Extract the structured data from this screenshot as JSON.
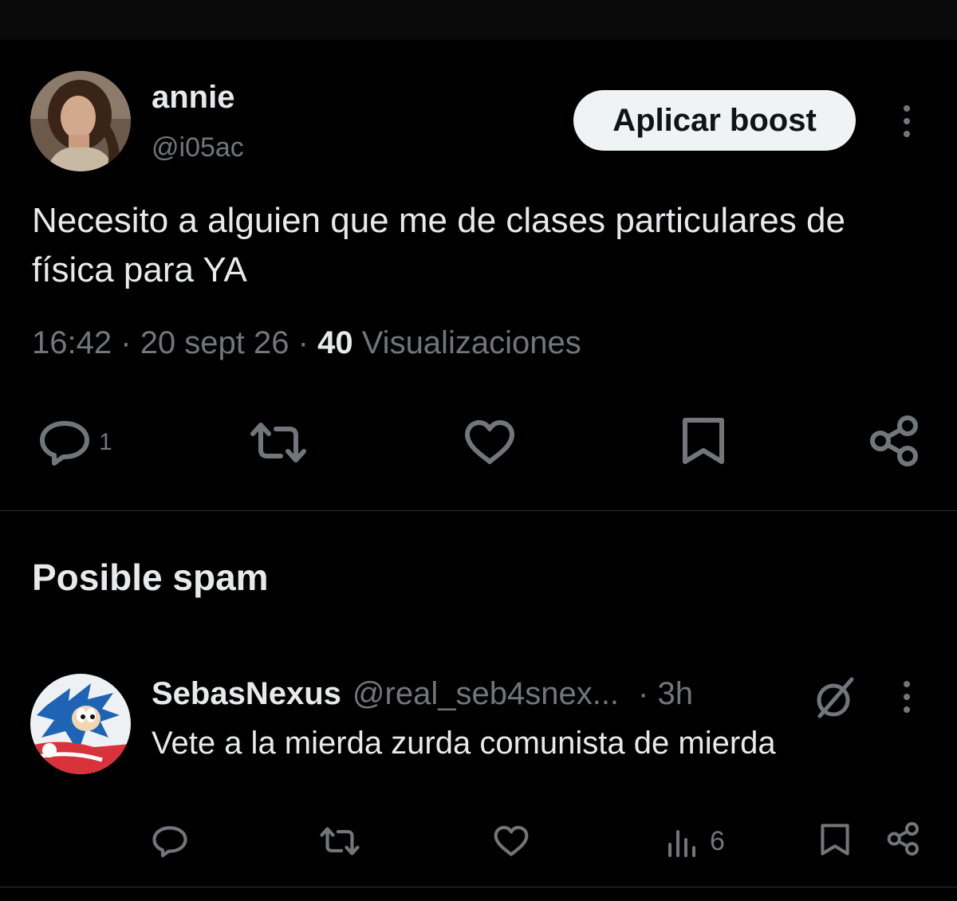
{
  "tweet": {
    "author_name": "annie",
    "author_handle": "@i05ac",
    "boost_label": "Aplicar boost",
    "text": "Necesito a alguien que me de clases particulares de física para YA",
    "time": "16:42",
    "date": "20 sept 26",
    "views_count": "40",
    "views_label": "Visualizaciones",
    "separator": "·",
    "actions": {
      "reply_count": "1"
    }
  },
  "spam_section": {
    "title": "Posible spam"
  },
  "reply": {
    "author_name": "SebasNexus",
    "author_handle": "@real_seb4snex...",
    "time": "· 3h",
    "text": "Vete a la mierda zurda comunista de mierda",
    "actions": {
      "views_count": "6"
    }
  },
  "icons": {
    "avatar_main": "avatar-photo",
    "avatar_reply": "sonic-avatar",
    "more": "more-vertical-icon",
    "reply": "comment-icon",
    "retweet": "retweet-icon",
    "like": "heart-icon",
    "bookmark": "bookmark-icon",
    "share": "share-icon",
    "views": "analytics-icon",
    "grok": "slashed-circle-icon"
  },
  "colors": {
    "background": "#000000",
    "text_primary": "#e7e9ea",
    "text_secondary": "#71767b",
    "icon": "#71767b",
    "button_bg": "#eff3f4",
    "divider": "#2f3336"
  }
}
